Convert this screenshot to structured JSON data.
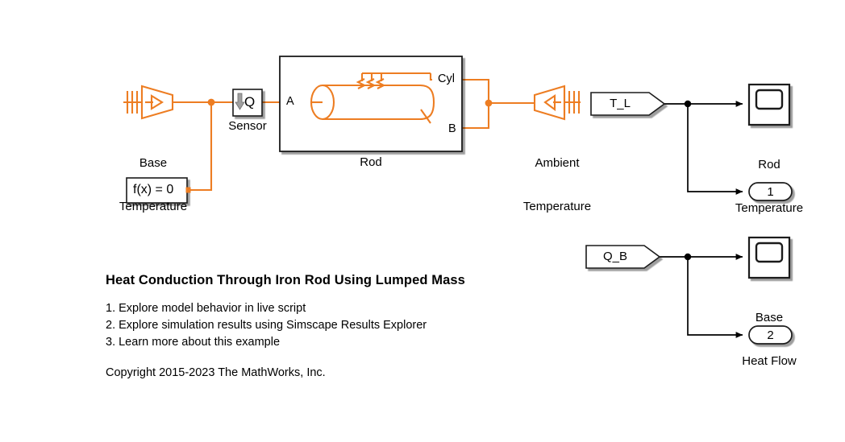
{
  "theme": {
    "physical_line_color": "#ED7D22",
    "signal_line_color": "#000000",
    "block_border_color": "#1A1A1A",
    "block_fill_color": "#FFFFFF",
    "background_color": "#FFFFFF",
    "text_color": "#000000",
    "sensor_arrow_color": "#9E9E9E"
  },
  "blocks": {
    "base_temperature": {
      "label": "Base\nTemperature",
      "label_line1": "Base",
      "label_line2": "Temperature",
      "icon": "temperature-source-icon"
    },
    "sensor": {
      "label": "Sensor",
      "symbol": "Q",
      "icon": "heat-flow-sensor-icon"
    },
    "solver": {
      "label": "f(x) = 0",
      "icon": "solver-configuration-icon"
    },
    "rod": {
      "label": "Rod",
      "ports": {
        "a": "A",
        "b": "B",
        "cyl": "Cyl"
      },
      "icon": "thermal-rod-subsystem-icon"
    },
    "ambient_temperature": {
      "label": "Ambient\nTemperature",
      "label_line1": "Ambient",
      "label_line2": "Temperature",
      "icon": "temperature-source-mirrored-icon"
    },
    "tag_tl": {
      "label": "T_L",
      "icon": "from-tag-icon"
    },
    "tag_qb": {
      "label": "Q_B",
      "icon": "from-tag-icon"
    },
    "scope_rod_temperature": {
      "label": "Rod\nTemperature",
      "label_line1": "Rod",
      "label_line2": "Temperature",
      "icon": "scope-icon"
    },
    "scope_base_heat_flow": {
      "label": "Base\nHeat Flow",
      "label_line1": "Base",
      "label_line2": "Heat Flow",
      "icon": "scope-icon"
    },
    "outport_1": {
      "label": "1",
      "icon": "outport-icon"
    },
    "outport_2": {
      "label": "2",
      "icon": "outport-icon"
    }
  },
  "annotation": {
    "title": "Heat Conduction Through Iron Rod Using Lumped Mass",
    "items": [
      "1. Explore model behavior in live script",
      "2. Explore simulation results using Simscape Results Explorer",
      "3. Learn more about this example"
    ],
    "copyright": "Copyright 2015-2023 The MathWorks, Inc."
  }
}
